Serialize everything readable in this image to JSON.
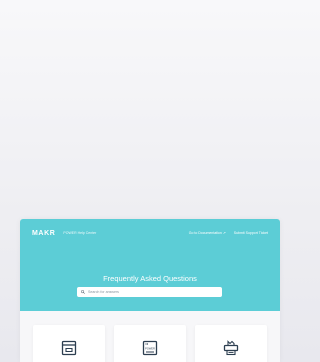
{
  "header": {
    "logo": "MAKR",
    "subtitle": "POWER Help Center",
    "links": [
      {
        "label": "Go to Documentation",
        "icon": "external-link-icon"
      },
      {
        "label": "Submit Support Ticket"
      }
    ]
  },
  "hero": {
    "title": "Frequently Asked Questions",
    "background_color": "#5ccdd6"
  },
  "search": {
    "placeholder": "Search for answers",
    "value": ""
  },
  "tiles": [
    {
      "icon": "tray-icon",
      "label": ""
    },
    {
      "icon": "device-icon",
      "device_text": "POWER",
      "label": ""
    },
    {
      "icon": "printer-icon",
      "label": ""
    }
  ]
}
